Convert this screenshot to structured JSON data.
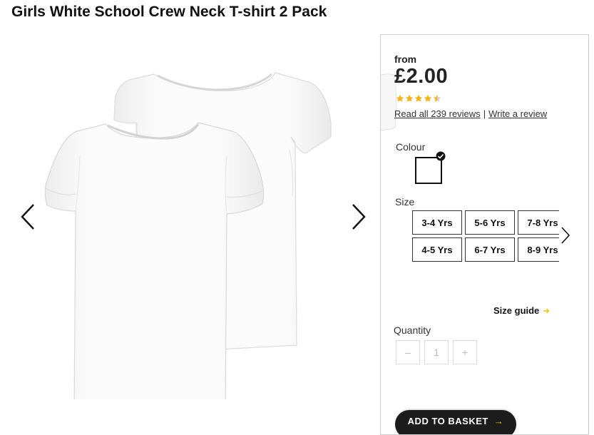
{
  "product": {
    "title": "Girls White School Crew Neck T-shirt 2 Pack"
  },
  "gallery": {
    "prev_icon": "chevron-left-icon",
    "next_icon": "chevron-right-icon"
  },
  "pricing": {
    "from_label": "from",
    "price": "£2.00"
  },
  "rating": {
    "stars": 4.5,
    "max_stars": 5,
    "star_color": "#f3b41b",
    "read_reviews": "Read all 239 reviews",
    "separator": "|",
    "write_review": "Write a review"
  },
  "colour": {
    "label": "Colour",
    "selected": "White",
    "swatch_color": "#ffffff"
  },
  "size": {
    "label": "Size",
    "options": [
      "3-4 Yrs",
      "5-6 Yrs",
      "7-8 Yrs",
      "4-5 Yrs",
      "6-7 Yrs",
      "8-9 Yrs"
    ],
    "next_icon": "chevron-right-icon"
  },
  "size_guide": {
    "label": "Size guide",
    "icon": "arrow-right-icon",
    "accent": "#f3c200"
  },
  "quantity": {
    "label": "Quantity",
    "minus": "–",
    "value": "1",
    "plus": "+"
  },
  "basket": {
    "label": "ADD TO BASKET",
    "icon": "arrow-right-icon"
  }
}
